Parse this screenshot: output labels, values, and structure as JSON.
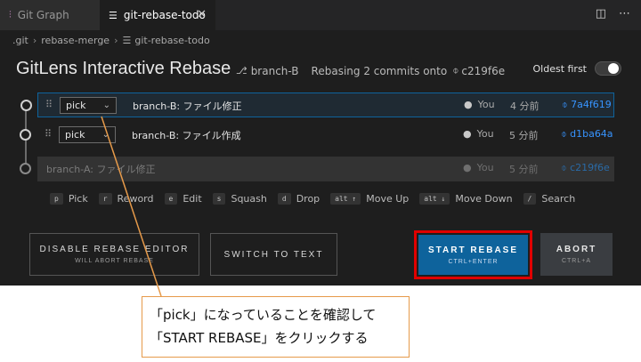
{
  "tabs": [
    {
      "label": "Git Graph",
      "icon": "git-graph-icon"
    },
    {
      "label": "git-rebase-todo",
      "icon": "list-icon",
      "close": "✕"
    }
  ],
  "breadcrumb": [
    ".git",
    "rebase-merge",
    "git-rebase-todo"
  ],
  "header": {
    "title": "GitLens Interactive Rebase",
    "branch": "branch-B",
    "rebasing": "Rebasing 2 commits onto",
    "onto_sha": "c219f6e",
    "oldest_first_label": "Oldest first"
  },
  "commits": [
    {
      "action": "pick",
      "message": "branch-B: ファイル修正",
      "author": "You",
      "time": "4 分前",
      "sha": "7a4f619"
    },
    {
      "action": "pick",
      "message": "branch-B: ファイル作成",
      "author": "You",
      "time": "5 分前",
      "sha": "d1ba64a"
    },
    {
      "message": "branch-A: ファイル修正",
      "author": "You",
      "time": "5 分前",
      "sha": "c219f6e"
    }
  ],
  "shortcuts": [
    {
      "key": "p",
      "label": "Pick"
    },
    {
      "key": "r",
      "label": "Reword"
    },
    {
      "key": "e",
      "label": "Edit"
    },
    {
      "key": "s",
      "label": "Squash"
    },
    {
      "key": "d",
      "label": "Drop"
    },
    {
      "key": "alt ↑",
      "label": "Move Up"
    },
    {
      "key": "alt ↓",
      "label": "Move Down"
    },
    {
      "key": "/",
      "label": "Search"
    }
  ],
  "buttons": {
    "disable": {
      "label": "DISABLE REBASE EDITOR",
      "sub": "WILL ABORT REBASE"
    },
    "switch": {
      "label": "SWITCH TO TEXT"
    },
    "start": {
      "label": "START REBASE",
      "sub": "CTRL+ENTER"
    },
    "abort": {
      "label": "ABORT",
      "sub": "CTRL+A"
    }
  },
  "annotation": {
    "line1": "「pick」になっていることを確認して",
    "line2": "「START REBASE」をクリックする"
  },
  "colors": {
    "highlight_border": "#e00000",
    "callout_border": "#e69a4a",
    "primary_button": "#0e639c",
    "sha_link": "#3794ff"
  }
}
